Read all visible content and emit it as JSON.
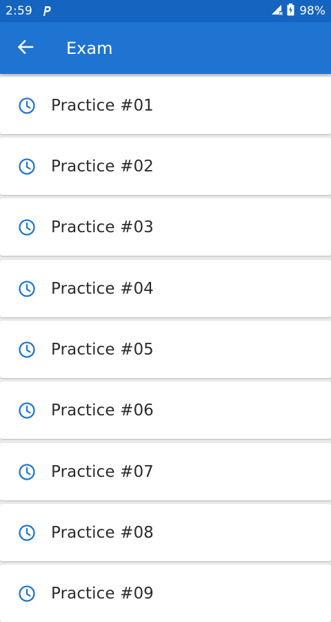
{
  "status_bar": {
    "time": "2:59",
    "battery_percent": "98%",
    "icons": [
      "parking-p-icon",
      "signal-icon",
      "battery-charging-icon"
    ]
  },
  "app_bar": {
    "title": "Exam",
    "back_icon": "arrow-left-icon"
  },
  "colors": {
    "status_bar": "#1565c0",
    "app_bar": "#1e74d0",
    "icon_accent": "#1e74d0",
    "background": "#ebebeb"
  },
  "items": [
    {
      "label": "Practice #01",
      "icon": "clock-icon"
    },
    {
      "label": "Practice #02",
      "icon": "clock-icon"
    },
    {
      "label": "Practice #03",
      "icon": "clock-icon"
    },
    {
      "label": "Practice #04",
      "icon": "clock-icon"
    },
    {
      "label": "Practice #05",
      "icon": "clock-icon"
    },
    {
      "label": "Practice #06",
      "icon": "clock-icon"
    },
    {
      "label": "Practice #07",
      "icon": "clock-icon"
    },
    {
      "label": "Practice #08",
      "icon": "clock-icon"
    },
    {
      "label": "Practice #09",
      "icon": "clock-icon"
    }
  ]
}
